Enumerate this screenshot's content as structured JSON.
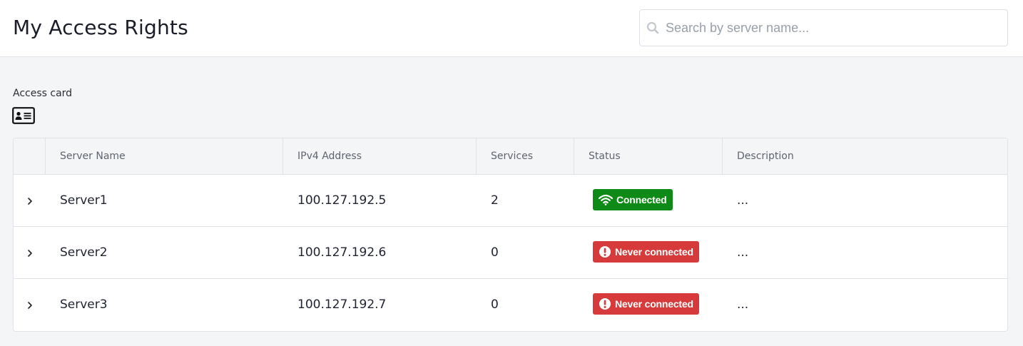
{
  "header": {
    "title": "My Access Rights",
    "search_placeholder": "Search by server name...",
    "search_value": ""
  },
  "access_card": {
    "label": "Access card",
    "icon": "id-card-icon"
  },
  "table": {
    "columns": [
      "",
      "Server Name",
      "IPv4 Address",
      "Services",
      "Status",
      "Description"
    ],
    "rows": [
      {
        "name": "Server1",
        "ip": "100.127.192.5",
        "services": "2",
        "status": "Connected",
        "status_type": "connected",
        "description": "..."
      },
      {
        "name": "Server2",
        "ip": "100.127.192.6",
        "services": "0",
        "status": "Never connected",
        "status_type": "never",
        "description": "..."
      },
      {
        "name": "Server3",
        "ip": "100.127.192.7",
        "services": "0",
        "status": "Never connected",
        "status_type": "never",
        "description": "..."
      }
    ]
  },
  "colors": {
    "connected": "#0e8a16",
    "never_connected": "#d63a3a",
    "header_bg": "#ffffff",
    "page_bg": "#f4f5f7"
  }
}
